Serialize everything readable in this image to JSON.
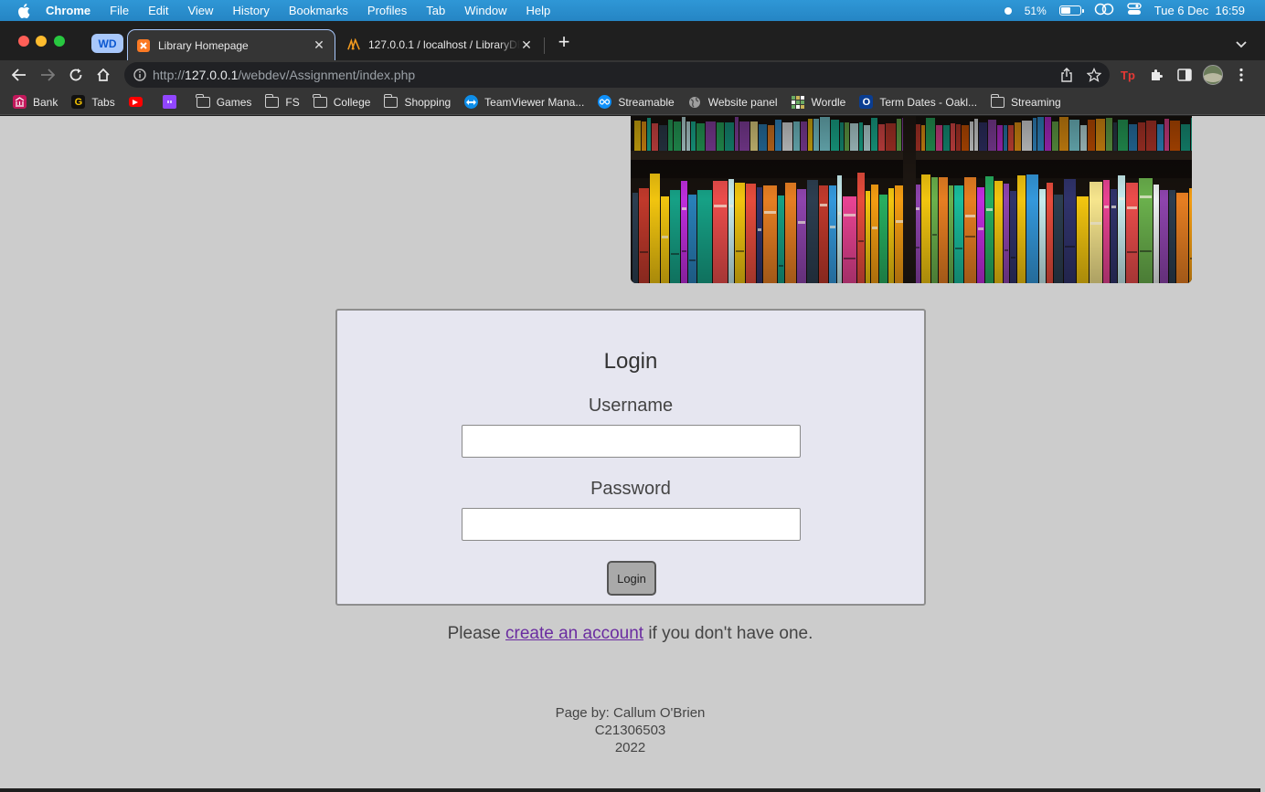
{
  "menubar": {
    "app_name": "Chrome",
    "menus": [
      "File",
      "Edit",
      "View",
      "History",
      "Bookmarks",
      "Profiles",
      "Tab",
      "Window",
      "Help"
    ],
    "battery_percent": "51%",
    "battery_level": 0.51,
    "datetime": "Tue 6 Dec  16:59"
  },
  "browser": {
    "profile_chip": "WD",
    "tabs": [
      {
        "title": "Library Homepage",
        "active": true
      },
      {
        "title": "127.0.0.1 / localhost / LibraryDB",
        "active": false
      }
    ],
    "url_host": "127.0.0.1",
    "url_prefix": "http://",
    "url_path": "/webdev/Assignment/index.php"
  },
  "bookmarks": [
    {
      "label": "Bank",
      "icon": "bank-icon",
      "color": "#c2185b"
    },
    {
      "label": "Tabs",
      "icon": "g-icon",
      "color": "#111111"
    },
    {
      "label": "",
      "icon": "youtube-icon",
      "color": "#ff0000"
    },
    {
      "label": "",
      "icon": "twitch-icon",
      "color": "#9146ff"
    },
    {
      "label": "Games",
      "icon": "folder-icon"
    },
    {
      "label": "FS",
      "icon": "folder-icon"
    },
    {
      "label": "College",
      "icon": "folder-icon"
    },
    {
      "label": "Shopping",
      "icon": "folder-icon"
    },
    {
      "label": "TeamViewer Mana...",
      "icon": "teamviewer-icon",
      "color": "#0e8ee9"
    },
    {
      "label": "Streamable",
      "icon": "streamable-icon",
      "color": "#0f90fa"
    },
    {
      "label": "Website panel",
      "icon": "globe-icon",
      "color": "#9e9e9e"
    },
    {
      "label": "Wordle",
      "icon": "wordle-icon",
      "color": "#6aaa64"
    },
    {
      "label": "Term Dates - Oakl...",
      "icon": "outlook-icon",
      "color": "#0a3d91"
    },
    {
      "label": "Streaming",
      "icon": "folder-icon"
    }
  ],
  "page": {
    "login": {
      "title": "Login",
      "username_label": "Username",
      "username_value": "",
      "password_label": "Password",
      "password_value": "",
      "button_label": "Login"
    },
    "signup": {
      "prefix": "Please ",
      "link_text": "create an account",
      "suffix": " if you don't have one."
    },
    "footer": {
      "line1": "Page by: Callum O'Brien",
      "line2": "C21306503",
      "line3": "2022"
    }
  },
  "colors": {
    "page_background": "#cccccc",
    "login_box_background": "#e6e6f0",
    "link_color": "#6a2ca0",
    "menubar": "#2585c4"
  }
}
